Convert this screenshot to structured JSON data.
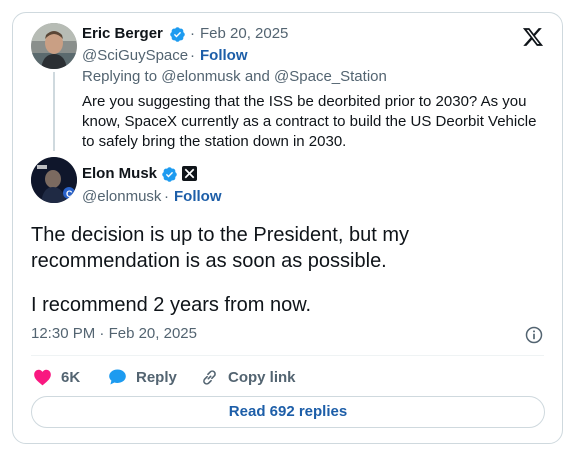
{
  "quoted_post": {
    "author_name": "Eric Berger",
    "separator": "·",
    "date": "Feb 20, 2025",
    "handle": "@SciGuySpace",
    "follow": "Follow",
    "replying_prefix": "Replying to",
    "replying_user1": "@elonmusk",
    "replying_and": "and",
    "replying_user2": "@Space_Station",
    "text": "Are you suggesting that the ISS be deorbited prior to 2030? As you know, SpaceX currently as a contract to build the US Deorbit Vehicle to safely bring the station down in 2030."
  },
  "main_post": {
    "author_name": "Elon Musk",
    "handle": "@elonmusk",
    "separator": "·",
    "follow": "Follow",
    "text_line1": "The decision is up to the President, but my",
    "text_line2": "recommendation is as soon as possible.",
    "text_line3": "I recommend 2 years from now.",
    "time": "12:30 PM",
    "date": "Feb 20, 2025"
  },
  "actions": {
    "likes": "6K",
    "reply": "Reply",
    "copy_link": "Copy link"
  },
  "read_replies": "Read 692 replies",
  "icons": {
    "platform_logo": "x-logo-icon",
    "verified": "verified-badge-icon",
    "affiliate": "x-affiliate-badge-icon",
    "info": "info-icon",
    "like": "heart-icon",
    "reply": "speech-bubble-icon",
    "copy_link": "link-icon"
  },
  "colors": {
    "verified_blue": "#1d9bf0",
    "link_blue": "#1d5ea8",
    "like_red": "#f91880",
    "text_grey": "#536471",
    "border": "#cfd9de"
  }
}
